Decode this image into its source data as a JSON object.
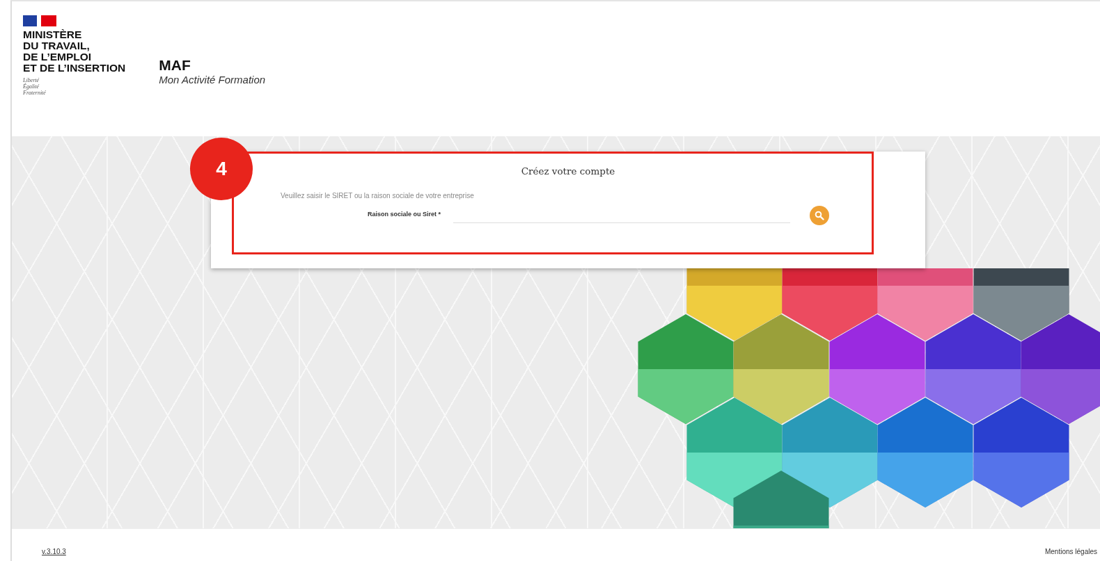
{
  "header": {
    "ministry_lines": [
      "MINISTÈRE",
      "DU TRAVAIL,",
      "DE L’EMPLOI",
      "ET DE L’INSERTION"
    ],
    "motto_lines": [
      "Liberté",
      "Égalité",
      "Fraternité"
    ],
    "app_title": "MAF",
    "app_subtitle": "Mon Activité Formation"
  },
  "annotation": {
    "number": "4"
  },
  "card": {
    "title": "Créez votre compte",
    "instruction": "Veuillez saisir le SIRET ou la raison sociale de votre entreprise",
    "field_label": "Raison sociale ou Siret *"
  },
  "footer": {
    "version": "v.3.10.3",
    "legal_link": "Mentions légales"
  }
}
